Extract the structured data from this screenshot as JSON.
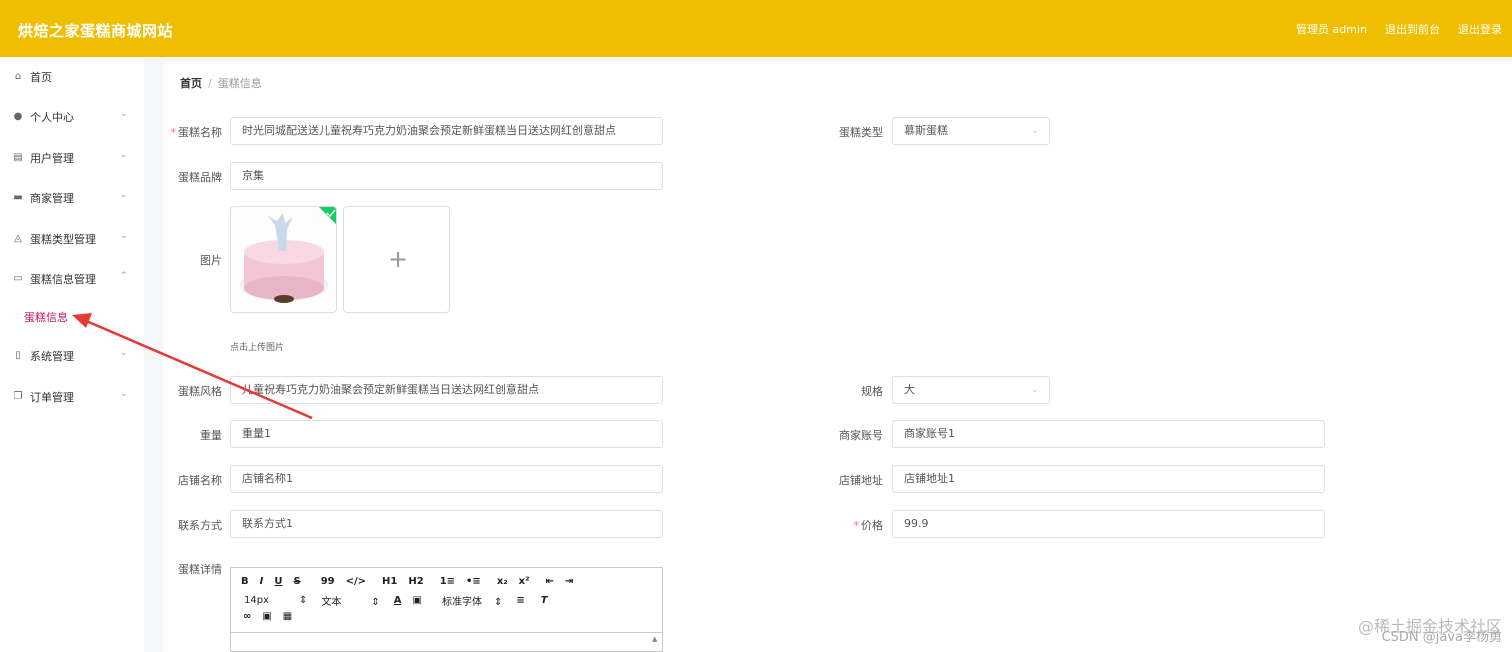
{
  "header": {
    "logo": "烘焙之家蛋糕商城网站",
    "admin_label": "管理员 admin",
    "front_link": "退出到前台",
    "logout_link": "退出登录",
    "bg_color": "#f0be00"
  },
  "sidebar": {
    "items": [
      {
        "label": "首页",
        "icon": "home-icon",
        "has_chevron": false
      },
      {
        "label": "个人中心",
        "icon": "user-icon",
        "has_chevron": true
      },
      {
        "label": "用户管理",
        "icon": "grid-icon",
        "has_chevron": true
      },
      {
        "label": "商家管理",
        "icon": "monitor-icon",
        "has_chevron": true
      },
      {
        "label": "蛋糕类型管理",
        "icon": "bell-icon",
        "has_chevron": true
      },
      {
        "label": "蛋糕信息管理",
        "icon": "chat-icon",
        "has_chevron": true
      },
      {
        "label": "系统管理",
        "icon": "mic-icon",
        "has_chevron": true
      },
      {
        "label": "订单管理",
        "icon": "copy-icon",
        "has_chevron": true
      }
    ],
    "sub_item": "蛋糕信息",
    "sub_color": "#c2185b"
  },
  "breadcrumb": {
    "home": "首页",
    "sep": "/",
    "current": "蛋糕信息"
  },
  "form": {
    "name_label": "蛋糕名称",
    "name_value": "时光同城配送送儿童祝寿巧克力奶油聚会预定新鲜蛋糕当日送达网红创意甜点",
    "type_label": "蛋糕类型",
    "type_value": "慕斯蛋糕",
    "brand_label": "蛋糕品牌",
    "brand_value": "京集",
    "image_label": "图片",
    "upload_hint": "点击上传图片",
    "style_label": "蛋糕风格",
    "style_value": "儿童祝寿巧克力奶油聚会预定新鲜蛋糕当日送达网红创意甜点",
    "spec_label": "规格",
    "spec_value": "大",
    "weight_label": "重量",
    "weight_value": "重量1",
    "merchant_label": "商家账号",
    "merchant_value": "商家账号1",
    "shop_label": "店铺名称",
    "shop_value": "店铺名称1",
    "addr_label": "店铺地址",
    "addr_value": "店铺地址1",
    "contact_label": "联系方式",
    "contact_value": "联系方式1",
    "price_label": "价格",
    "price_value": "99.9",
    "detail_label": "蛋糕详情",
    "required_mark": "*"
  },
  "editor": {
    "row1": [
      "B",
      "I",
      "U",
      "S",
      "99",
      "</>",
      "H1",
      "H2",
      "1≡",
      "•≡",
      "x₂",
      "x²",
      "⇤",
      "⇥"
    ],
    "font_size": "14px",
    "block_type": "文本",
    "font_family": "标准字体",
    "select_arrow": "⇕"
  },
  "watermark": {
    "line1": "@稀土掘金技术社区",
    "line2": "CSDN @java李杨勇"
  }
}
